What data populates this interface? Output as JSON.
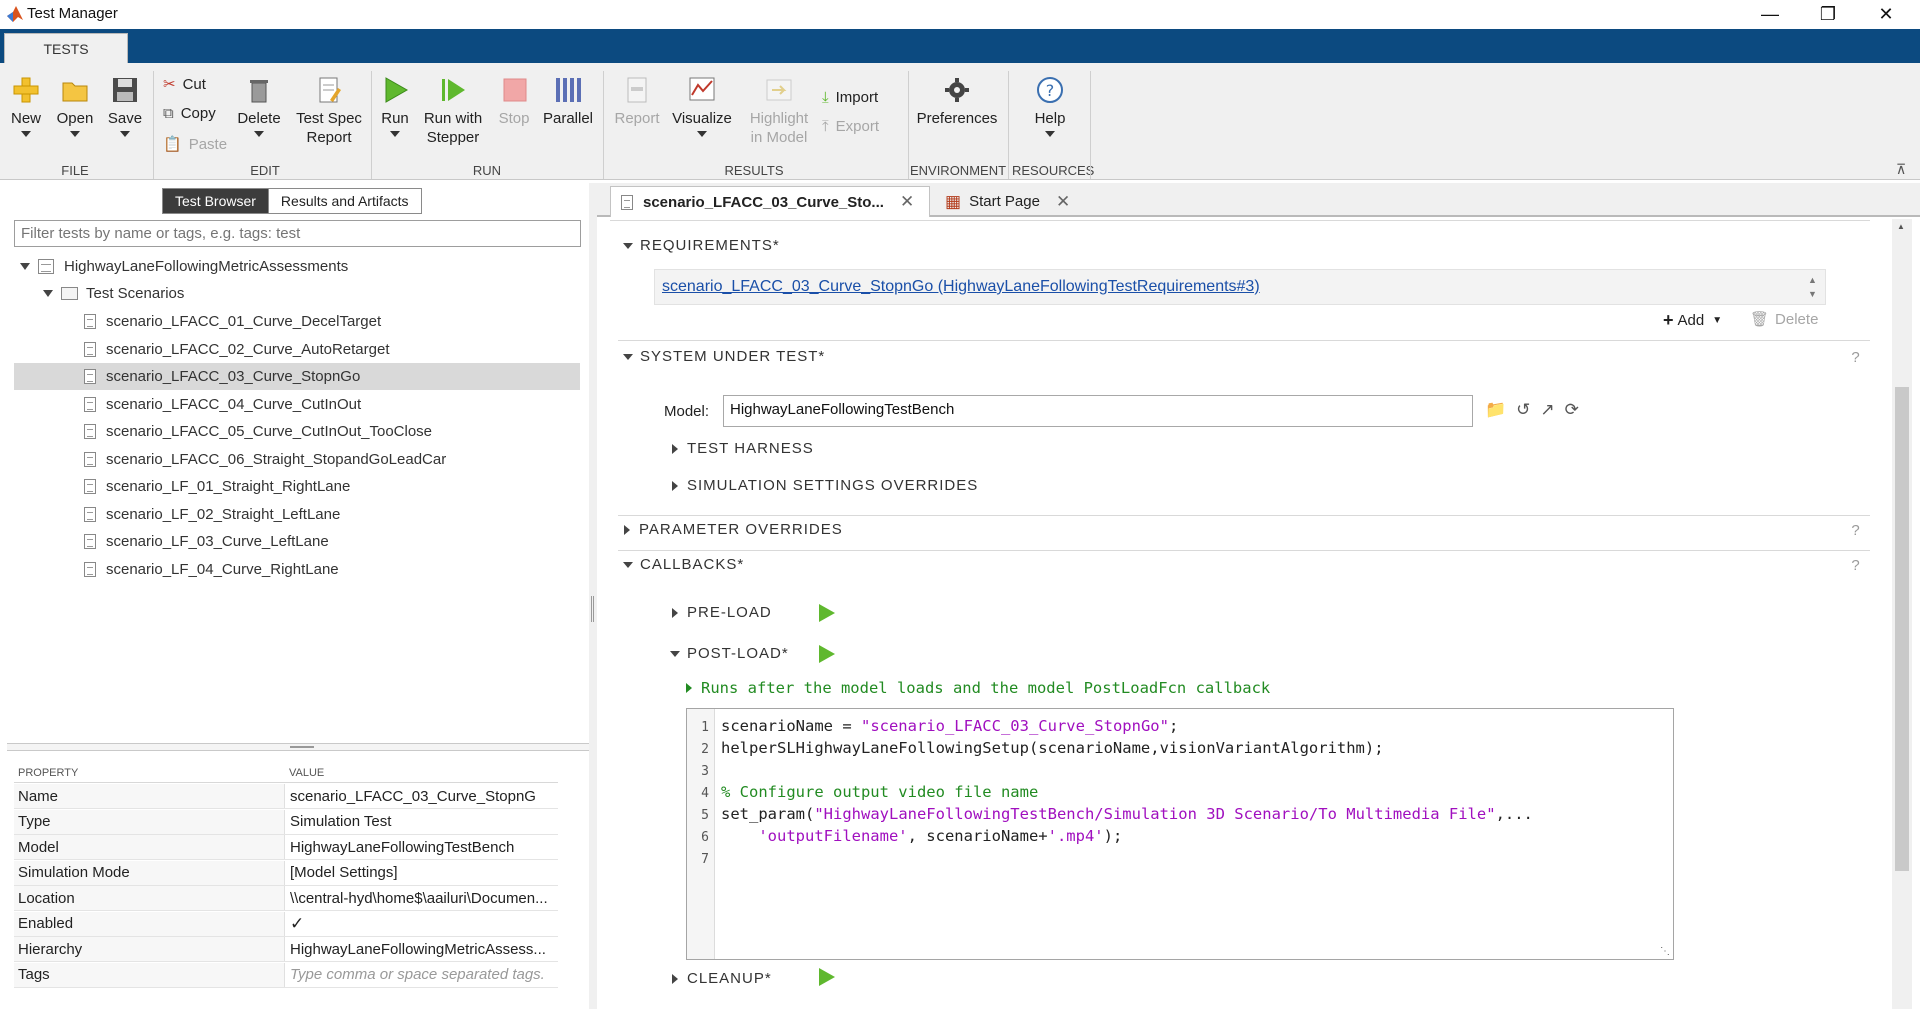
{
  "window": {
    "title": "Test Manager"
  },
  "ribbon": {
    "tab": "TESTS",
    "file": {
      "label": "FILE",
      "new": "New",
      "open": "Open",
      "save": "Save"
    },
    "edit": {
      "label": "EDIT",
      "cut": "Cut",
      "copy": "Copy",
      "paste": "Paste",
      "delete": "Delete",
      "report_line1": "Test Spec",
      "report_line2": "Report"
    },
    "run": {
      "label": "RUN",
      "run": "Run",
      "stepper_line1": "Run with",
      "stepper_line2": "Stepper",
      "stop": "Stop",
      "parallel": "Parallel"
    },
    "results": {
      "label": "RESULTS",
      "report": "Report",
      "visualize": "Visualize",
      "highlight_line1": "Highlight",
      "highlight_line2": "in Model",
      "import": "Import",
      "export": "Export"
    },
    "environment": {
      "label": "ENVIRONMENT",
      "preferences": "Preferences"
    },
    "resources": {
      "label": "RESOURCES",
      "help": "Help"
    }
  },
  "left": {
    "tabs": [
      "Test Browser",
      "Results and Artifacts"
    ],
    "filter_placeholder": "Filter tests by name or tags, e.g. tags: test",
    "tree": {
      "root": "HighwayLaneFollowingMetricAssessments",
      "suite": "Test Scenarios",
      "tests": [
        "scenario_LFACC_01_Curve_DecelTarget",
        "scenario_LFACC_02_Curve_AutoRetarget",
        "scenario_LFACC_03_Curve_StopnGo",
        "scenario_LFACC_04_Curve_CutInOut",
        "scenario_LFACC_05_Curve_CutInOut_TooClose",
        "scenario_LFACC_06_Straight_StopandGoLeadCar",
        "scenario_LF_01_Straight_RightLane",
        "scenario_LF_02_Straight_LeftLane",
        "scenario_LF_03_Curve_LeftLane",
        "scenario_LF_04_Curve_RightLane"
      ]
    },
    "props": {
      "head_property": "PROPERTY",
      "head_value": "VALUE",
      "rows": [
        {
          "k": "Name",
          "v": "scenario_LFACC_03_Curve_StopnG"
        },
        {
          "k": "Type",
          "v": "Simulation Test"
        },
        {
          "k": "Model",
          "v": "HighwayLaneFollowingTestBench"
        },
        {
          "k": "Simulation Mode",
          "v": "[Model Settings]"
        },
        {
          "k": "Location",
          "v": "\\\\central-hyd\\home$\\aailuri\\Documen..."
        },
        {
          "k": "Enabled",
          "v": "✓"
        },
        {
          "k": "Hierarchy",
          "v": "HighwayLaneFollowingMetricAssess..."
        },
        {
          "k": "Tags",
          "v": "Type comma or space separated tags."
        }
      ]
    }
  },
  "doc_tabs": [
    {
      "label": "scenario_LFACC_03_Curve_Sto..."
    },
    {
      "label": "Start Page"
    }
  ],
  "main": {
    "requirements": {
      "title": "REQUIREMENTS*",
      "link": "scenario_LFACC_03_Curve_StopnGo (HighwayLaneFollowingTestRequirements#3)",
      "add": "Add",
      "delete": "Delete"
    },
    "sut": {
      "title": "SYSTEM UNDER TEST*",
      "model_label": "Model:",
      "model_value": "HighwayLaneFollowingTestBench",
      "harness": "TEST HARNESS",
      "sim_overrides": "SIMULATION SETTINGS OVERRIDES"
    },
    "param_overrides": "PARAMETER OVERRIDES",
    "callbacks": {
      "title": "CALLBACKS*",
      "preload": "PRE-LOAD",
      "postload": "POST-LOAD*",
      "postload_desc": "Runs after the model loads and the model PostLoadFcn callback",
      "cleanup": "CLEANUP*",
      "code_numbers": [
        "1",
        "2",
        "3",
        "4",
        "5",
        "6",
        "7"
      ],
      "code": {
        "l1a": "scenarioName = ",
        "l1b": "\"scenario_LFACC_03_Curve_StopnGo\"",
        "l1c": ";",
        "l2": "helperSLHighwayLaneFollowingSetup(scenarioName,visionVariantAlgorithm);",
        "l4": "% Configure output video file name",
        "l5a": "set_param(",
        "l5b": "\"HighwayLaneFollowingTestBench/Simulation 3D Scenario/To Multimedia File\"",
        "l5c": ",...",
        "l6a": "    ",
        "l6b": "'outputFilename'",
        "l6c": ", scenarioName+",
        "l6d": "'.mp4'",
        "l6e": ");"
      }
    }
  }
}
